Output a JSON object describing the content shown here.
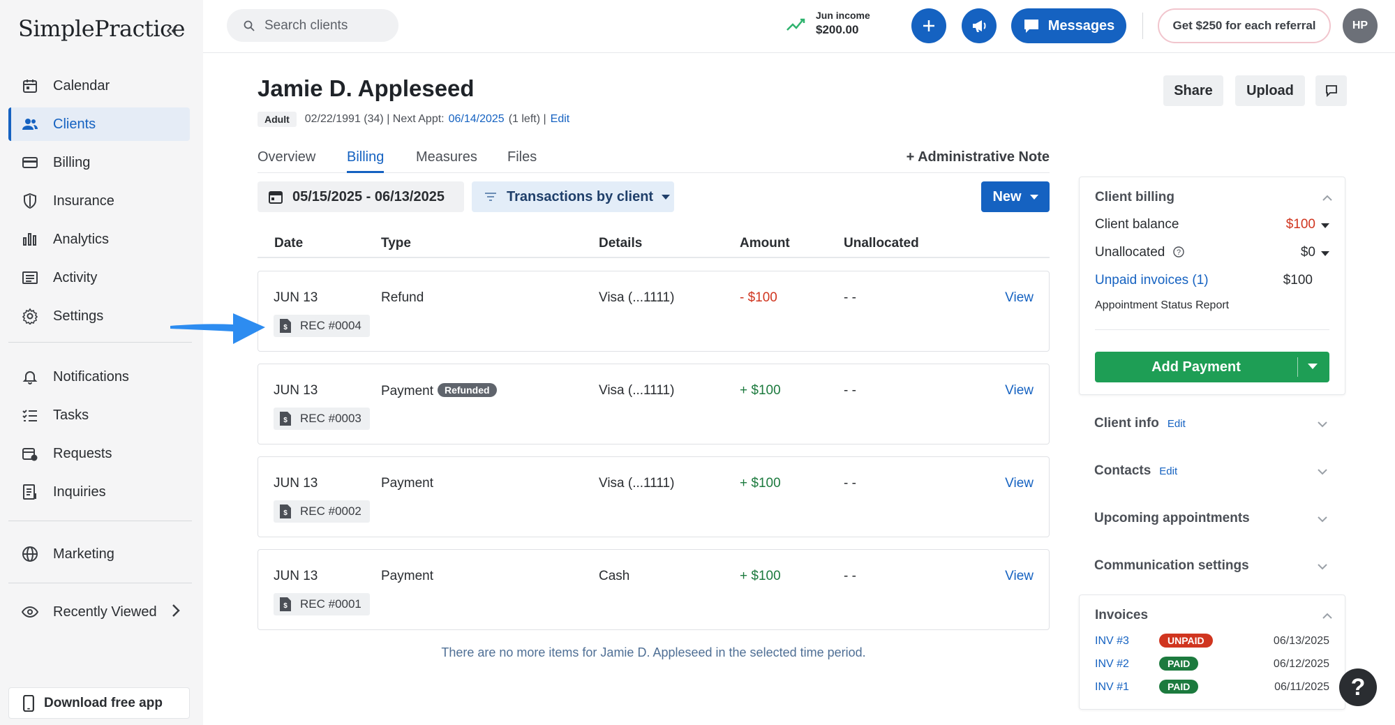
{
  "brand": {
    "logo": "SimplePractice"
  },
  "sidebar": {
    "items": [
      {
        "label": "Calendar",
        "icon": "calendar-icon"
      },
      {
        "label": "Clients",
        "icon": "users-icon"
      },
      {
        "label": "Billing",
        "icon": "credit-card-icon"
      },
      {
        "label": "Insurance",
        "icon": "shield-icon"
      },
      {
        "label": "Analytics",
        "icon": "bar-chart-icon"
      },
      {
        "label": "Activity",
        "icon": "list-icon"
      },
      {
        "label": "Settings",
        "icon": "gear-icon"
      },
      {
        "label": "Notifications",
        "icon": "bell-icon"
      },
      {
        "label": "Tasks",
        "icon": "checklist-icon"
      },
      {
        "label": "Requests",
        "icon": "calendar-request-icon"
      },
      {
        "label": "Inquiries",
        "icon": "document-icon"
      },
      {
        "label": "Marketing",
        "icon": "globe-icon"
      },
      {
        "label": "Recently Viewed",
        "icon": "eye-icon"
      }
    ],
    "active": "Clients",
    "download_label": "Download free app"
  },
  "topbar": {
    "search_placeholder": "Search clients",
    "income_label": "Jun income",
    "income_value": "$200.00",
    "messages_label": "Messages",
    "referral_label": "Get $250 for each referral",
    "avatar_initials": "HP"
  },
  "client": {
    "name": "Jamie D. Appleseed",
    "badge": "Adult",
    "dob_age": "02/22/1991 (34) | Next Appt:",
    "next_appt": "06/14/2025",
    "appt_left": "(1 left) |",
    "edit_label": "Edit"
  },
  "header_buttons": {
    "share": "Share",
    "upload": "Upload"
  },
  "tabs": [
    {
      "label": "Overview"
    },
    {
      "label": "Billing"
    },
    {
      "label": "Measures"
    },
    {
      "label": "Files"
    }
  ],
  "active_tab": "Billing",
  "admin_note_label": "+ Administrative Note",
  "filters": {
    "date_range": "05/15/2025 - 06/13/2025",
    "transactions_label": "Transactions by client",
    "new_label": "New"
  },
  "table": {
    "headers": [
      "Date",
      "Type",
      "Details",
      "Amount",
      "Unallocated"
    ],
    "rows": [
      {
        "date": "JUN 13",
        "type": "Refund",
        "badge": "",
        "details": "Visa (...1111)",
        "amount": "- $100",
        "amount_kind": "negative",
        "unallocated": "- -",
        "receipt": "REC #0004",
        "action": "View"
      },
      {
        "date": "JUN 13",
        "type": "Payment",
        "badge": "Refunded",
        "details": "Visa (...1111)",
        "amount": "+ $100",
        "amount_kind": "positive",
        "unallocated": "- -",
        "receipt": "REC #0003",
        "action": "View"
      },
      {
        "date": "JUN 13",
        "type": "Payment",
        "badge": "",
        "details": "Visa (...1111)",
        "amount": "+ $100",
        "amount_kind": "positive",
        "unallocated": "- -",
        "receipt": "REC #0002",
        "action": "View"
      },
      {
        "date": "JUN 13",
        "type": "Payment",
        "badge": "",
        "details": "Cash",
        "amount": "+ $100",
        "amount_kind": "positive",
        "unallocated": "- -",
        "receipt": "REC #0001",
        "action": "View"
      }
    ],
    "footer": "There are no more items for Jamie D. Appleseed in the selected time period."
  },
  "client_billing": {
    "title": "Client billing",
    "balance_label": "Client balance",
    "balance_value": "$100",
    "unallocated_label": "Unallocated",
    "unallocated_value": "$0",
    "unpaid_label": "Unpaid invoices (1)",
    "unpaid_value": "$100",
    "status_report_label": "Appointment Status Report",
    "add_payment_label": "Add Payment"
  },
  "sections": [
    {
      "label": "Client info",
      "edit": "Edit"
    },
    {
      "label": "Contacts",
      "edit": "Edit"
    },
    {
      "label": "Upcoming appointments",
      "edit": ""
    },
    {
      "label": "Communication settings",
      "edit": ""
    }
  ],
  "invoices": {
    "title": "Invoices",
    "items": [
      {
        "number": "INV #3",
        "status": "UNPAID",
        "date": "06/13/2025"
      },
      {
        "number": "INV #2",
        "status": "PAID",
        "date": "06/12/2025"
      },
      {
        "number": "INV #1",
        "status": "PAID",
        "date": "06/11/2025"
      }
    ]
  },
  "colors": {
    "brand_blue": "#1562c1",
    "success_green": "#1e9e55",
    "danger_red": "#d0351f",
    "arrow_blue": "#2d8cf0"
  },
  "help_label": "?"
}
